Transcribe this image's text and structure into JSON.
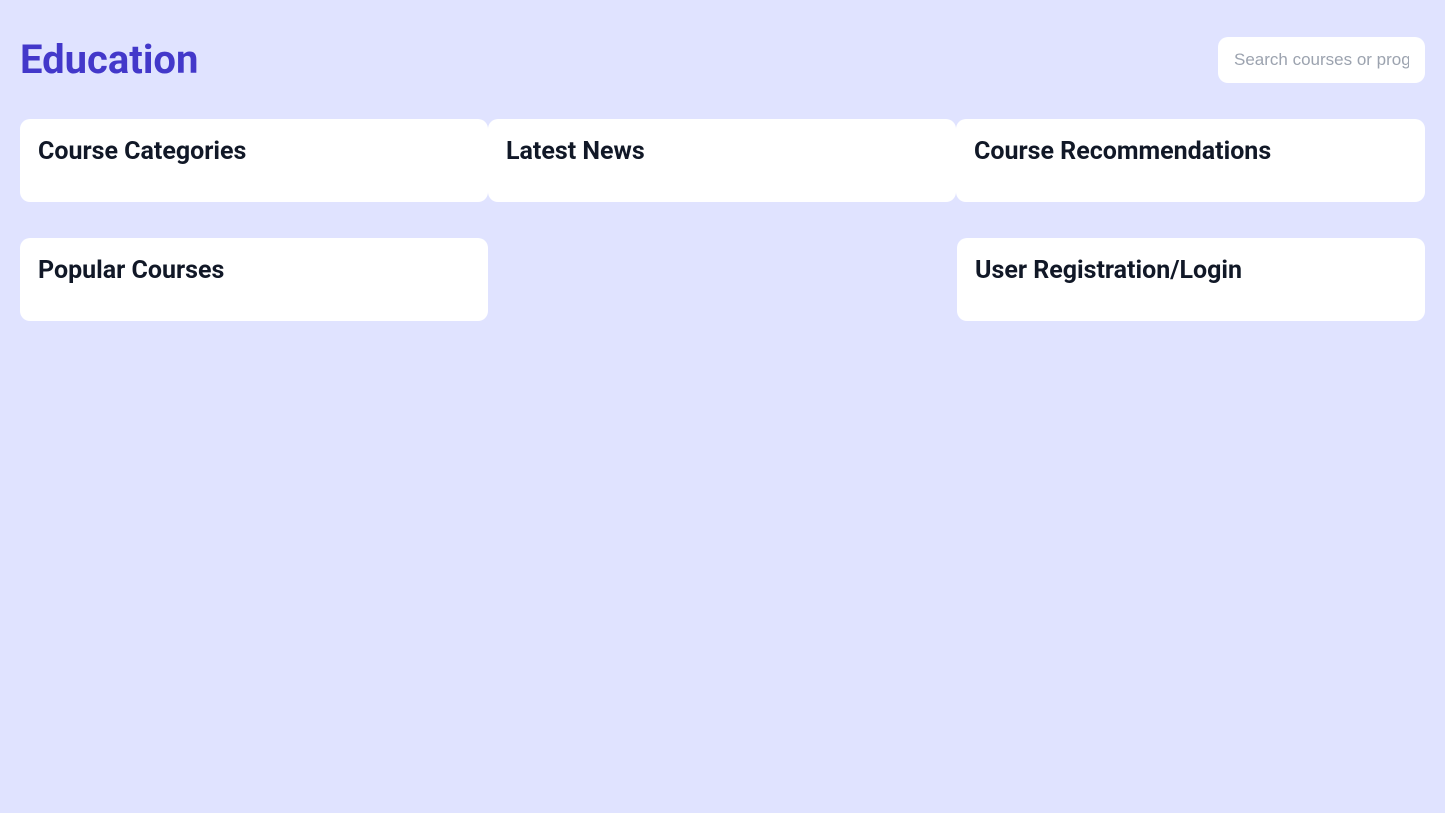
{
  "header": {
    "title": "Education",
    "search_placeholder": "Search courses or programs"
  },
  "cards": {
    "course_categories": {
      "title": "Course Categories"
    },
    "latest_news": {
      "title": "Latest News"
    },
    "course_recommendations": {
      "title": "Course Recommendations"
    },
    "popular_courses": {
      "title": "Popular Courses"
    },
    "user_registration": {
      "title": "User Registration/Login"
    }
  }
}
